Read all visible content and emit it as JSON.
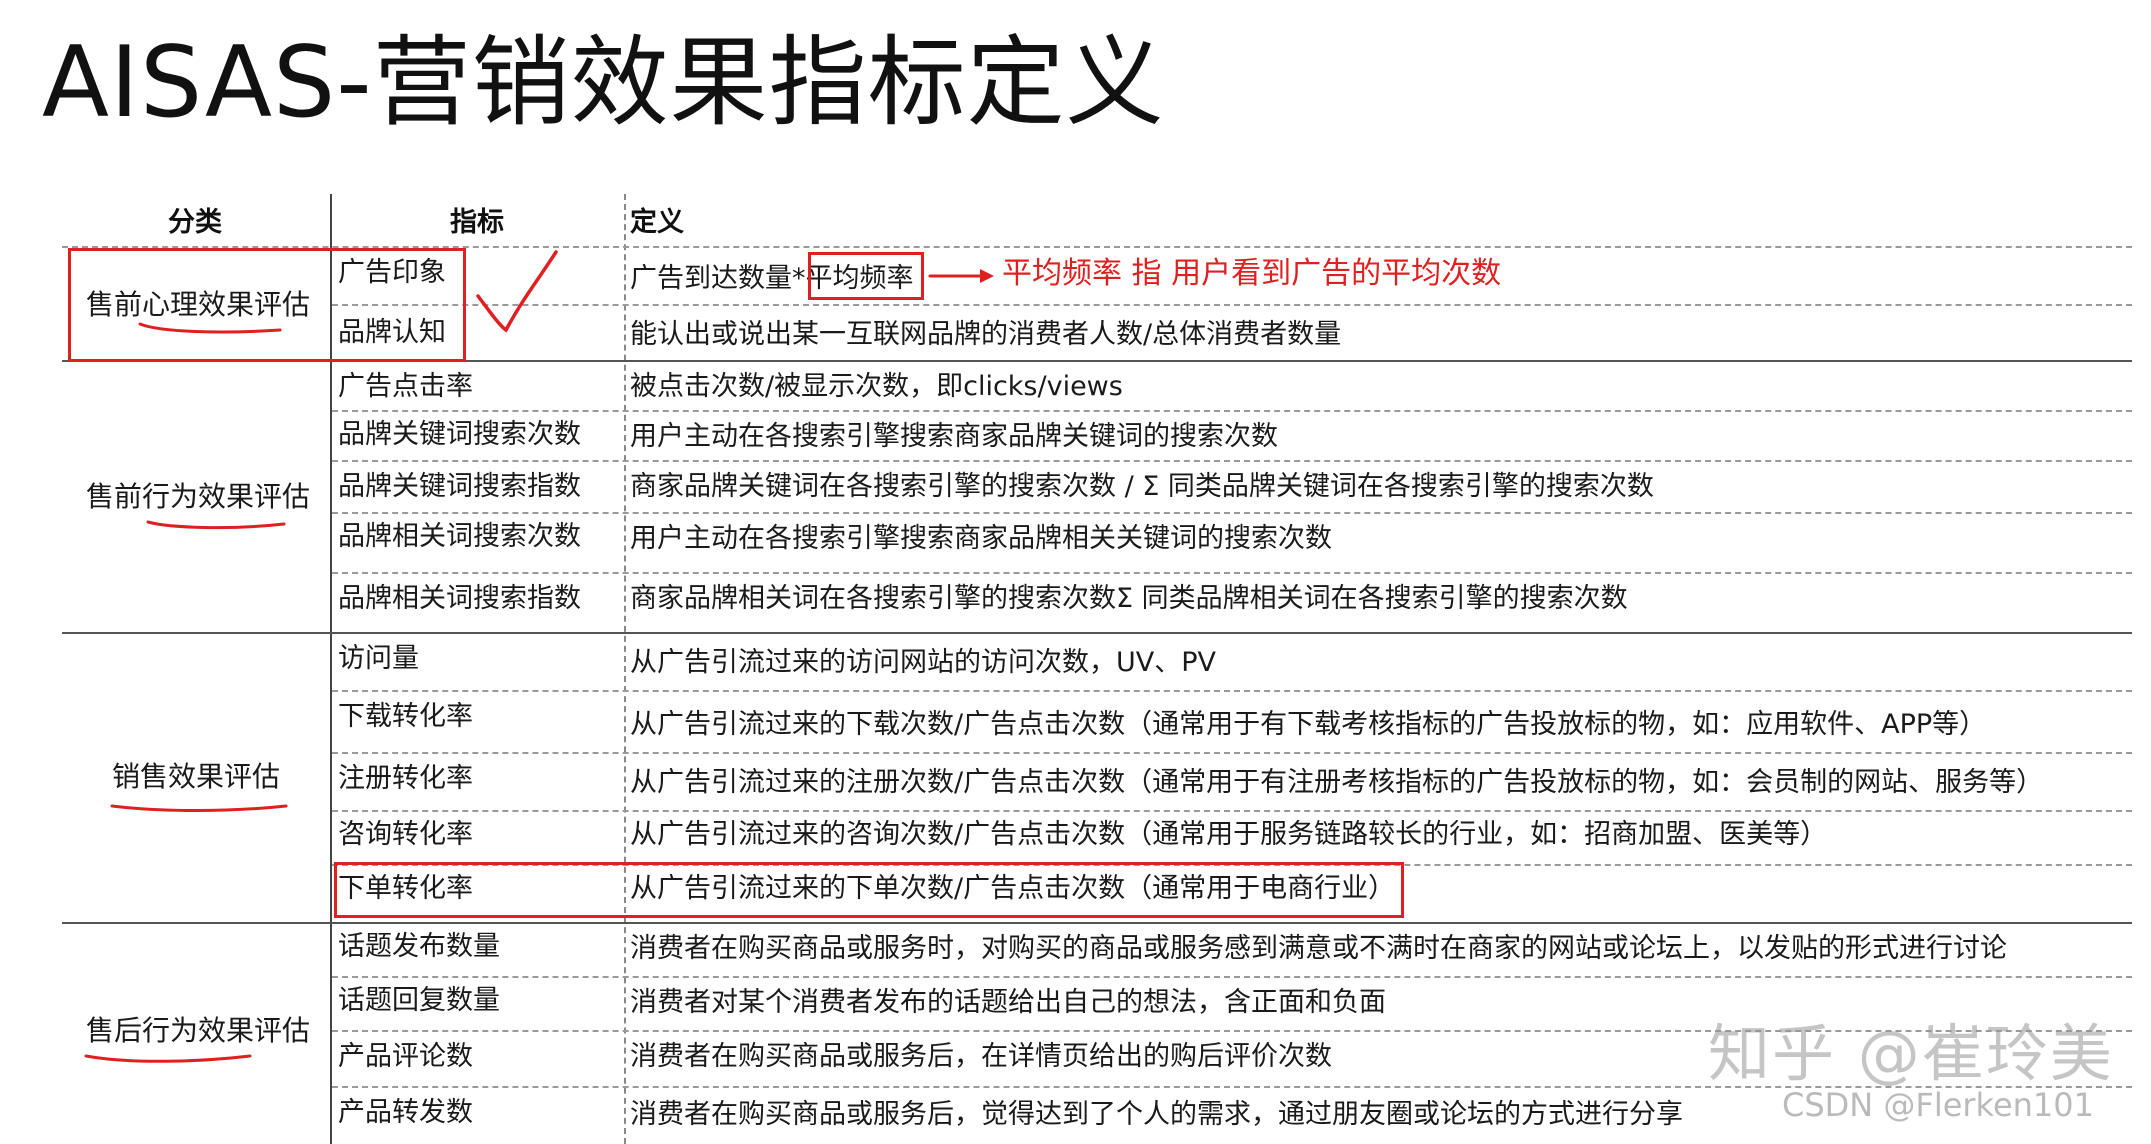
{
  "title": "AISAS-营销效果指标定义",
  "headers": {
    "category": "分类",
    "indicator": "指标",
    "definition": "定义"
  },
  "categories": [
    "售前心理效果评估",
    "售前行为效果评估",
    "销售效果评估",
    "售后行为效果评估"
  ],
  "rows": [
    {
      "indicator": "广告印象",
      "definition": "广告到达数量*平均频率"
    },
    {
      "indicator": "品牌认知",
      "definition": "能认出或说出某一互联网品牌的消费者人数/总体消费者数量"
    },
    {
      "indicator": "广告点击率",
      "definition": "被点击次数/被显示次数，即clicks/views"
    },
    {
      "indicator": "品牌关键词搜索次数",
      "definition": "用户主动在各搜索引擎搜索商家品牌关键词的搜索次数"
    },
    {
      "indicator": "品牌关键词搜索指数",
      "definition": "商家品牌关键词在各搜索引擎的搜索次数 / Σ 同类品牌关键词在各搜索引擎的搜索次数"
    },
    {
      "indicator": "品牌相关词搜索次数",
      "definition": "用户主动在各搜索引擎搜索商家品牌相关关键词的搜索次数"
    },
    {
      "indicator": "品牌相关词搜索指数",
      "definition": "商家品牌相关词在各搜索引擎的搜索次数Σ 同类品牌相关词在各搜索引擎的搜索次数"
    },
    {
      "indicator": "访问量",
      "definition": "从广告引流过来的访问网站的访问次数，UV、PV"
    },
    {
      "indicator": "下载转化率",
      "definition": "从广告引流过来的下载次数/广告点击次数（通常用于有下载考核指标的广告投放标的物，如：应用软件、APP等）"
    },
    {
      "indicator": "注册转化率",
      "definition": "从广告引流过来的注册次数/广告点击次数（通常用于有注册考核指标的广告投放标的物，如：会员制的网站、服务等）"
    },
    {
      "indicator": "咨询转化率",
      "definition": "从广告引流过来的咨询次数/广告点击次数（通常用于服务链路较长的行业，如：招商加盟、医美等）"
    },
    {
      "indicator": "下单转化率",
      "definition": "从广告引流过来的下单次数/广告点击次数（通常用于电商行业）"
    },
    {
      "indicator": "话题发布数量",
      "definition": "消费者在购买商品或服务时，对购买的商品或服务感到满意或不满时在商家的网站或论坛上，以发贴的形式进行讨论"
    },
    {
      "indicator": "话题回复数量",
      "definition": "消费者对某个消费者发布的话题给出自己的想法，含正面和负面"
    },
    {
      "indicator": "产品评论数",
      "definition": "消费者在购买商品或服务后，在详情页给出的购后评价次数"
    },
    {
      "indicator": "产品转发数",
      "definition": "消费者在购买商品或服务后，觉得达到了个人的需求，通过朋友圈或论坛的方式进行分享"
    }
  ],
  "annotation": {
    "note": "平均频率 指 用户看到广告的平均次数",
    "accent_color": "#e02020"
  },
  "watermark": {
    "zhihu": "知乎 @崔玲美",
    "csdn": "CSDN @Flerken101"
  }
}
